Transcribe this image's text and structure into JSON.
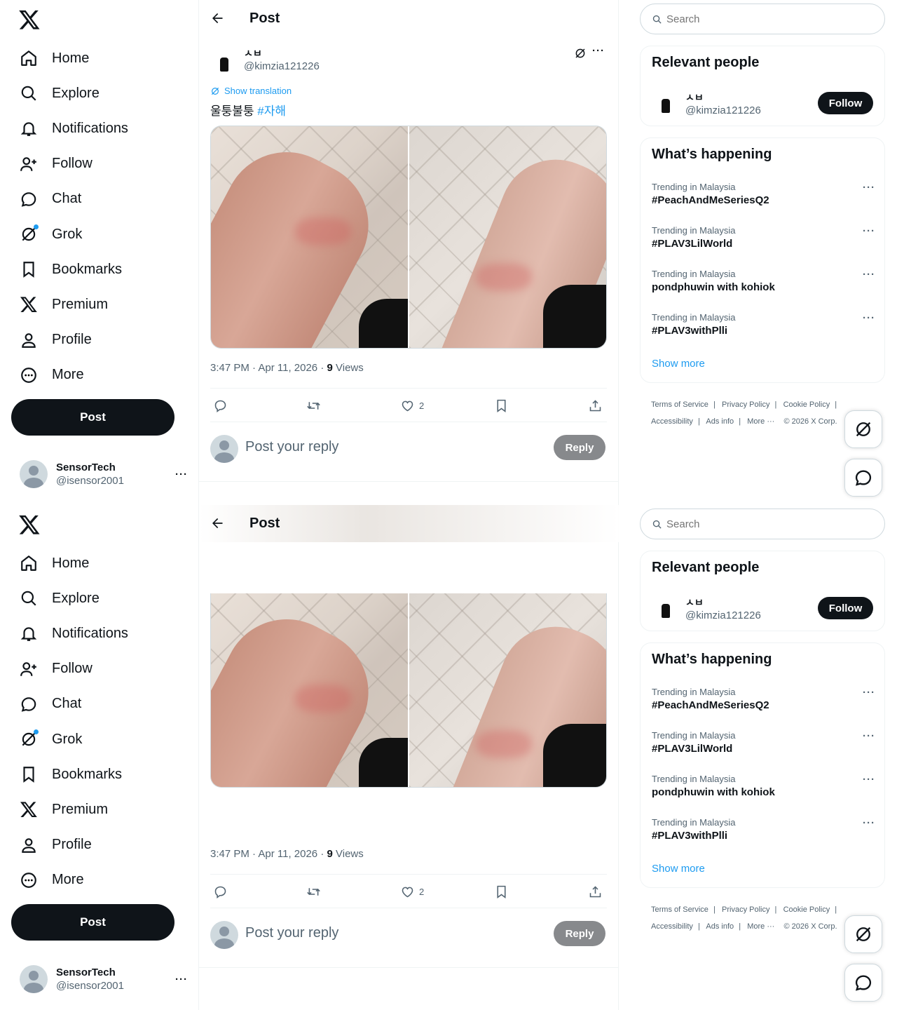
{
  "app": {
    "logo_icon": "x-logo-icon"
  },
  "nav": [
    {
      "label": "Home",
      "icon": "home-icon"
    },
    {
      "label": "Explore",
      "icon": "search-icon"
    },
    {
      "label": "Notifications",
      "icon": "bell-icon"
    },
    {
      "label": "Follow",
      "icon": "add-user-icon"
    },
    {
      "label": "Chat",
      "icon": "chat-icon"
    },
    {
      "label": "Grok",
      "icon": "grok-icon"
    },
    {
      "label": "Bookmarks",
      "icon": "bookmark-icon"
    },
    {
      "label": "Premium",
      "icon": "x-logo-icon"
    },
    {
      "label": "Profile",
      "icon": "profile-icon"
    },
    {
      "label": "More",
      "icon": "more-circle-icon"
    }
  ],
  "post_button": "Post",
  "account": {
    "name": "SensorTech",
    "handle": "@isensor2001",
    "more": "···"
  },
  "header": {
    "title": "Post"
  },
  "post": {
    "author_name": "ㅅㅂ",
    "author_handle": "@kimzia121226",
    "translate": "Show translation",
    "text": "울퉁불퉁",
    "hashtag": "#자해",
    "timestamp": "3:47 PM · Apr 11, 2026 · ",
    "views_count": "9",
    "views_label": "Views",
    "likes": "2"
  },
  "reply": {
    "placeholder": "Post your reply",
    "button": "Reply"
  },
  "search": {
    "placeholder": "Search"
  },
  "relevant": {
    "title": "Relevant people",
    "name": "ㅅㅂ",
    "handle": "@kimzia121226",
    "follow": "Follow"
  },
  "happening": {
    "title": "What’s happening",
    "trends": [
      {
        "category": "Trending in Malaysia",
        "title": "#PeachAndMeSeriesQ2"
      },
      {
        "category": "Trending in Malaysia",
        "title": "#PLAV3LilWorld"
      },
      {
        "category": "Trending in Malaysia",
        "title": "pondphuwin with kohiok"
      },
      {
        "category": "Trending in Malaysia",
        "title": "#PLAV3withPlli"
      }
    ],
    "show_more": "Show more"
  },
  "footer": {
    "terms": "Terms of Service",
    "privacy": "Privacy Policy",
    "cookie": "Cookie Policy",
    "access": "Accessibility",
    "ads": "Ads info",
    "more": "More ···",
    "copy": "© 2026 X Corp."
  },
  "colors": {
    "accent": "#1d9bf0",
    "text": "#0f1419",
    "muted": "#536471",
    "button": "#0f1419"
  }
}
